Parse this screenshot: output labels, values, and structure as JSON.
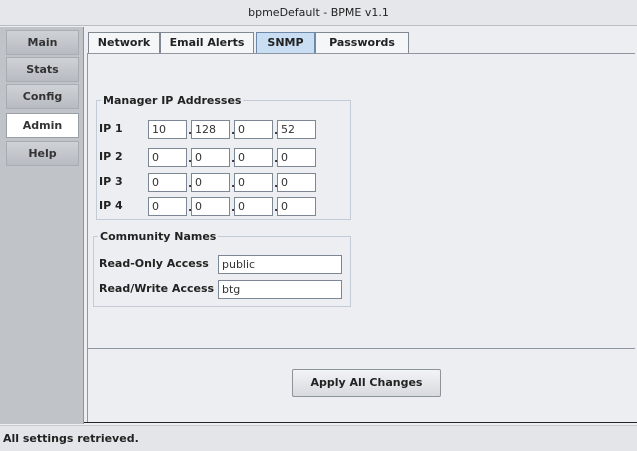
{
  "window": {
    "title": "bpmeDefault - BPME v1.1"
  },
  "sidebar": {
    "items": [
      {
        "label": "Main",
        "active": false
      },
      {
        "label": "Stats",
        "active": false
      },
      {
        "label": "Config",
        "active": false
      },
      {
        "label": "Admin",
        "active": true
      },
      {
        "label": "Help",
        "active": false
      }
    ]
  },
  "tabs": [
    {
      "label": "Network",
      "active": false
    },
    {
      "label": "Email Alerts",
      "active": false
    },
    {
      "label": "SNMP",
      "active": true
    },
    {
      "label": "Passwords",
      "active": false
    }
  ],
  "snmp": {
    "manager_group_label": "Manager IP Addresses",
    "ips": [
      {
        "label": "IP 1",
        "octets": [
          "10",
          "128",
          "0",
          "52"
        ]
      },
      {
        "label": "IP 2",
        "octets": [
          "0",
          "0",
          "0",
          "0"
        ]
      },
      {
        "label": "IP 3",
        "octets": [
          "0",
          "0",
          "0",
          "0"
        ]
      },
      {
        "label": "IP 4",
        "octets": [
          "0",
          "0",
          "0",
          "0"
        ]
      }
    ],
    "octet_separator": ".",
    "community_group_label": "Community Names",
    "read_only_label": "Read-Only Access",
    "read_only_value": "public",
    "read_write_label": "Read/Write Access",
    "read_write_value": "btg"
  },
  "actions": {
    "apply_label": "Apply All Changes"
  },
  "status": {
    "text": "All settings retrieved."
  },
  "colors": {
    "active_tab": "#c9ddf3",
    "sidebar_bg": "#c0c3c8",
    "active_sidebar_item": "#ffffff",
    "panel_bg": "#eceef1"
  }
}
